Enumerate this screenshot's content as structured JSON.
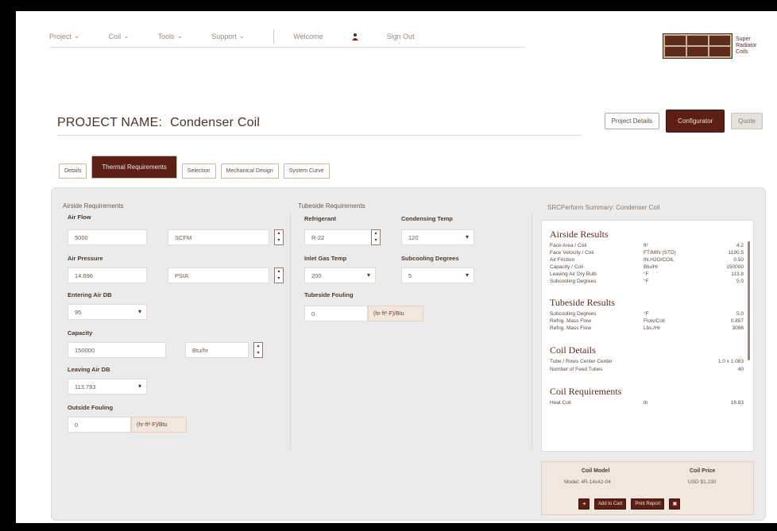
{
  "nav": {
    "items": [
      "Project",
      "Coil",
      "Tools",
      "Support"
    ],
    "welcome": "Welcome",
    "sign_out": "Sign Out"
  },
  "brand": {
    "logo_text": "Super Radiator Coils"
  },
  "project": {
    "label": "PROJECT NAME:",
    "name": "Condenser Coil"
  },
  "header_buttons": {
    "details": "Project Details",
    "configurator": "Configurator",
    "quote": "Quote"
  },
  "tabs": [
    "Details",
    "Thermal Requirements",
    "Selection",
    "Mechanical Design",
    "System Curve"
  ],
  "colors": {
    "accent": "#5c1f16",
    "panel": "#ebebeb",
    "unit_bg": "#f2e7dc"
  },
  "primary": {
    "title": "Airside Requirements",
    "air_flow": {
      "label": "Air Flow",
      "value": "5000",
      "unit": "SCFM"
    },
    "air_pressure": {
      "label": "Air Pressure",
      "value": "14.696",
      "unit": "PSIA"
    },
    "entering_air_db": {
      "label": "Entering Air DB",
      "value": "95"
    },
    "capacity": {
      "label": "Capacity",
      "value": "150000",
      "unit": "Btu/hr"
    },
    "leaving_air_db": {
      "label": "Leaving Air DB",
      "value": "113.783"
    },
    "outside_fouling": {
      "label": "Outside Fouling",
      "value": "0",
      "unit": "(hr·ft²·F)/Btu"
    }
  },
  "secondary": {
    "title": "Tubeside Requirements",
    "refrigerant": {
      "label": "Refrigerant",
      "value": "R-22"
    },
    "condensing_temp": {
      "label": "Condensing Temp",
      "value": "120"
    },
    "inlet_gas_temp": {
      "label": "Inlet Gas Temp",
      "value": "200"
    },
    "subcooling_degrees": {
      "label": "Subcooling Degrees",
      "value": "5"
    },
    "tubeside_fouling": {
      "label": "Tubeside Fouling",
      "value": "0",
      "unit": "(hr·ft²·F)/Btu"
    }
  },
  "results": {
    "title": "SRCPerform Summary: Condenser Coil",
    "airside": {
      "heading": "Airside Results",
      "rows": [
        [
          "Face Area / Coil",
          "ft²",
          "4.2"
        ],
        [
          "Face Velocity / Coil",
          "FT/MIN (STD)",
          "1190.5"
        ],
        [
          "Air Friction",
          "IN.H2O/COIL",
          "0.50"
        ],
        [
          "Capacity / Coil",
          "Btu/Hr",
          "150000"
        ],
        [
          "Leaving Air Dry Bulb",
          "°F",
          "113.8"
        ],
        [
          "Subcooling Degrees",
          "°F",
          "5.0"
        ]
      ]
    },
    "tubeside": {
      "heading": "Tubeside Results",
      "rows": [
        [
          "Subcooling Degrees",
          "°F",
          "5.0"
        ],
        [
          "Refrig. Mass Flow",
          "Flow/Coil",
          "0.857"
        ],
        [
          "Refrig. Mass Flow",
          "Lbs./Hr",
          "3086"
        ]
      ]
    },
    "coil_details": {
      "heading": "Coil Details",
      "rows": [
        [
          "Tube / Rows Center Center",
          "",
          "1.0 x 1.083"
        ],
        [
          "Number of Feed Tubes",
          "",
          "40"
        ]
      ]
    },
    "coil_requirements": {
      "heading": "Coil Requirements",
      "rows": [
        [
          "Heat Coil",
          "lb",
          "16.83"
        ]
      ]
    }
  },
  "footer": {
    "model_label": "Coil Model",
    "model_value": "Model: 4R-14x42-04",
    "price_label": "Coil Price",
    "price_value": "USD $1,230",
    "btn_a": "Add to Cart",
    "btn_b": "Print Report"
  }
}
